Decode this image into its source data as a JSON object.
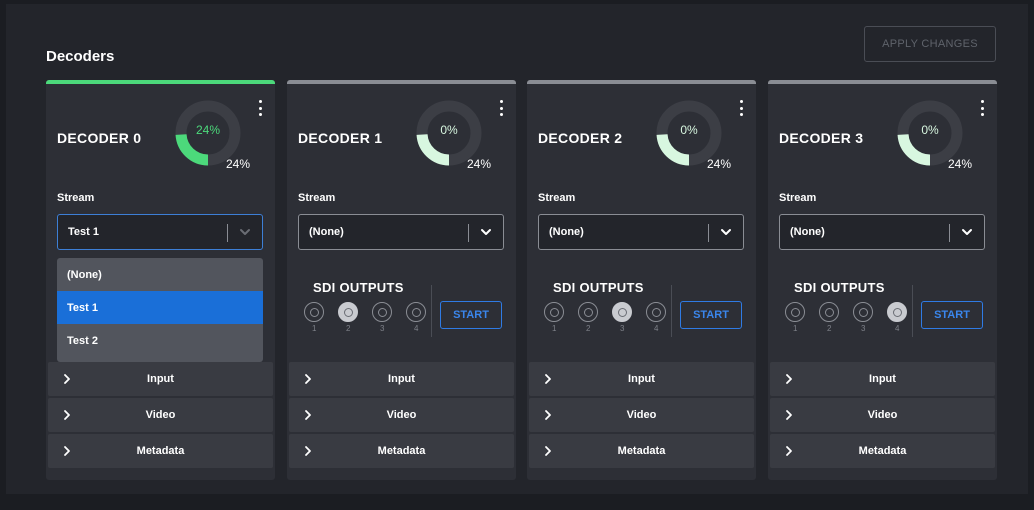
{
  "page": {
    "title": "Decoders",
    "apply_label": "APPLY CHANGES"
  },
  "colors": {
    "accent_green": "#4cd97b",
    "gauge_light": "#d8f7e0",
    "gauge_track": "#3c3e45",
    "bar_active": "#4cd97b",
    "bar_inactive": "#8a8d94",
    "start_blue": "#2f7be5",
    "selected_blue": "#1a6fd8"
  },
  "decoders": [
    {
      "title": "DECODER 0",
      "gauge_fraction": 0.24,
      "gauge_label": "24%",
      "gauge_sub": "24%",
      "active": true,
      "stream_label": "Stream",
      "stream_value": "Test 1",
      "dropdown_open": true,
      "dropdown_options": [
        "(None)",
        "Test 1",
        "Test 2"
      ],
      "dropdown_selected": "Test 1",
      "sdi_title": "",
      "sdi_outputs": [],
      "start_label": "",
      "sections": [
        "Input",
        "Video",
        "Metadata"
      ]
    },
    {
      "title": "DECODER 1",
      "gauge_fraction": 0.24,
      "gauge_label": "0%",
      "gauge_sub": "24%",
      "active": false,
      "stream_label": "Stream",
      "stream_value": "(None)",
      "dropdown_open": false,
      "sdi_title": "SDI OUTPUTS",
      "sdi_outputs": [
        {
          "num": "1",
          "on": false
        },
        {
          "num": "2",
          "on": true
        },
        {
          "num": "3",
          "on": false
        },
        {
          "num": "4",
          "on": false
        }
      ],
      "start_label": "START",
      "sections": [
        "Input",
        "Video",
        "Metadata"
      ]
    },
    {
      "title": "DECODER 2",
      "gauge_fraction": 0.24,
      "gauge_label": "0%",
      "gauge_sub": "24%",
      "active": false,
      "stream_label": "Stream",
      "stream_value": "(None)",
      "dropdown_open": false,
      "sdi_title": "SDI OUTPUTS",
      "sdi_outputs": [
        {
          "num": "1",
          "on": false
        },
        {
          "num": "2",
          "on": false
        },
        {
          "num": "3",
          "on": true
        },
        {
          "num": "4",
          "on": false
        }
      ],
      "start_label": "START",
      "sections": [
        "Input",
        "Video",
        "Metadata"
      ]
    },
    {
      "title": "DECODER 3",
      "gauge_fraction": 0.24,
      "gauge_label": "0%",
      "gauge_sub": "24%",
      "active": false,
      "stream_label": "Stream",
      "stream_value": "(None)",
      "dropdown_open": false,
      "sdi_title": "SDI OUTPUTS",
      "sdi_outputs": [
        {
          "num": "1",
          "on": false
        },
        {
          "num": "2",
          "on": false
        },
        {
          "num": "3",
          "on": false
        },
        {
          "num": "4",
          "on": true
        }
      ],
      "start_label": "START",
      "sections": [
        "Input",
        "Video",
        "Metadata"
      ]
    }
  ]
}
